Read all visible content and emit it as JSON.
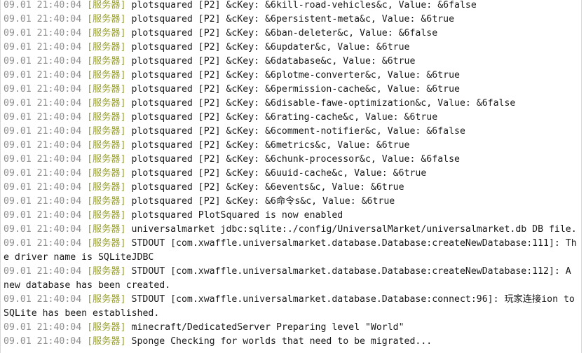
{
  "console": {
    "lines": [
      {
        "time": "09.01 21:40:04",
        "tag": "[服务器]",
        "text": "plotsquared [P2] &cKey: &6kill-road-vehicles&c, Value: &6false"
      },
      {
        "time": "09.01 21:40:04",
        "tag": "[服务器]",
        "text": "plotsquared [P2] &cKey: &6persistent-meta&c, Value: &6true"
      },
      {
        "time": "09.01 21:40:04",
        "tag": "[服务器]",
        "text": "plotsquared [P2] &cKey: &6ban-deleter&c, Value: &6false"
      },
      {
        "time": "09.01 21:40:04",
        "tag": "[服务器]",
        "text": "plotsquared [P2] &cKey: &6updater&c, Value: &6true"
      },
      {
        "time": "09.01 21:40:04",
        "tag": "[服务器]",
        "text": "plotsquared [P2] &cKey: &6database&c, Value: &6true"
      },
      {
        "time": "09.01 21:40:04",
        "tag": "[服务器]",
        "text": "plotsquared [P2] &cKey: &6plotme-converter&c, Value: &6true"
      },
      {
        "time": "09.01 21:40:04",
        "tag": "[服务器]",
        "text": "plotsquared [P2] &cKey: &6permission-cache&c, Value: &6true"
      },
      {
        "time": "09.01 21:40:04",
        "tag": "[服务器]",
        "text": "plotsquared [P2] &cKey: &6disable-fawe-optimization&c, Value: &6false"
      },
      {
        "time": "09.01 21:40:04",
        "tag": "[服务器]",
        "text": "plotsquared [P2] &cKey: &6rating-cache&c, Value: &6true"
      },
      {
        "time": "09.01 21:40:04",
        "tag": "[服务器]",
        "text": "plotsquared [P2] &cKey: &6comment-notifier&c, Value: &6false"
      },
      {
        "time": "09.01 21:40:04",
        "tag": "[服务器]",
        "text": "plotsquared [P2] &cKey: &6metrics&c, Value: &6true"
      },
      {
        "time": "09.01 21:40:04",
        "tag": "[服务器]",
        "text": "plotsquared [P2] &cKey: &6chunk-processor&c, Value: &6false"
      },
      {
        "time": "09.01 21:40:04",
        "tag": "[服务器]",
        "text": "plotsquared [P2] &cKey: &6uuid-cache&c, Value: &6true"
      },
      {
        "time": "09.01 21:40:04",
        "tag": "[服务器]",
        "text": "plotsquared [P2] &cKey: &6events&c, Value: &6true"
      },
      {
        "time": "09.01 21:40:04",
        "tag": "[服务器]",
        "text": "plotsquared [P2] &cKey: &6命令s&c, Value: &6true"
      },
      {
        "time": "09.01 21:40:04",
        "tag": "[服务器]",
        "text": "plotsquared PlotSquared is now enabled"
      },
      {
        "time": "09.01 21:40:04",
        "tag": "[服务器]",
        "text": "universalmarket jdbc:sqlite:./config/UniversalMarket/universalmarket.db DB file."
      },
      {
        "time": "09.01 21:40:04",
        "tag": "[服务器]",
        "text": "STDOUT [com.xwaffle.universalmarket.database.Database:createNewDatabase:111]: The driver name is SQLiteJDBC"
      },
      {
        "time": "09.01 21:40:04",
        "tag": "[服务器]",
        "text": "STDOUT [com.xwaffle.universalmarket.database.Database:createNewDatabase:112]: A new database has been created."
      },
      {
        "time": "09.01 21:40:04",
        "tag": "[服务器]",
        "text": "STDOUT [com.xwaffle.universalmarket.database.Database:connect:96]: 玩家连接ion to SQLite has been established."
      },
      {
        "time": "09.01 21:40:04",
        "tag": "[服务器]",
        "text": "minecraft/DedicatedServer Preparing level \"World\""
      },
      {
        "time": "09.01 21:40:04",
        "tag": "[服务器]",
        "text": "Sponge Checking for worlds that need to be migrated..."
      }
    ]
  },
  "colors": {
    "timestamp": "#8f8f8f",
    "tag": "#9aa12b",
    "text": "#1a1a1a"
  }
}
